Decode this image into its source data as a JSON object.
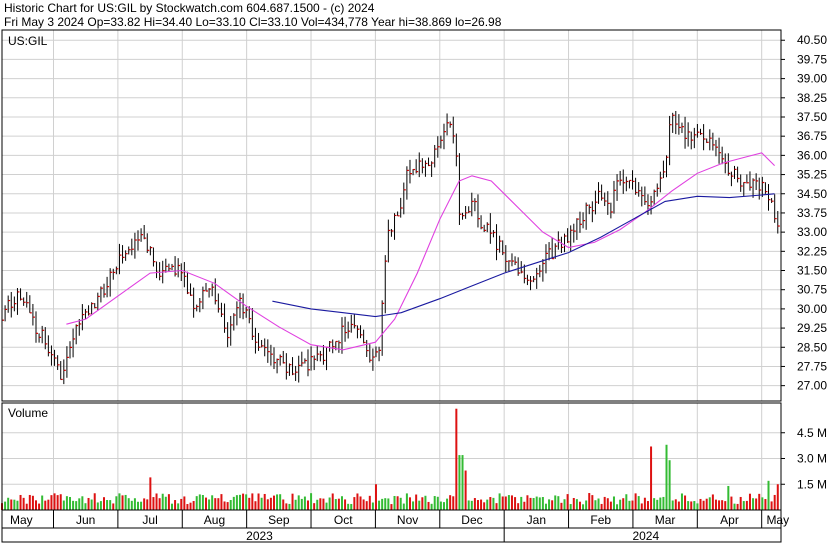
{
  "header": {
    "line1": "Historic Chart for US:GIL by Stockwatch.com 604.687.1500 - (c) 2024",
    "line2": "Fri May  3 2024  Op=33.82  Hi=34.40  Lo=33.10  Cl=33.10  Vol=434,778  Year hi=38.869  lo=26.98"
  },
  "colors": {
    "background": "#ffffff",
    "frame": "#000000",
    "grid": "#d0d0d0",
    "candle_stem": "#000000",
    "close_tick": "#cc0000",
    "ma_short": "#e040e0",
    "ma_long": "#1a1aa0",
    "vol_up": "#33bb33",
    "vol_down": "#dd1111"
  },
  "chart_data": [
    {
      "type": "candlestick",
      "title": "Historic Chart for US:GIL by Stockwatch.com 604.687.1500 - (c) 2024",
      "symbol_label": "US:GIL",
      "ylim": [
        26.4,
        40.9
      ],
      "yticks": [
        27.0,
        27.75,
        28.5,
        29.25,
        30.0,
        30.75,
        31.5,
        32.25,
        33.0,
        33.75,
        34.5,
        35.25,
        36.0,
        36.75,
        37.5,
        38.25,
        39.0,
        39.75,
        40.5
      ],
      "grid": true,
      "x_range_months": [
        0,
        12.1
      ],
      "month_labels": [
        {
          "label": "May",
          "pos": 0.3
        },
        {
          "label": "Jun",
          "pos": 1.3
        },
        {
          "label": "Jul",
          "pos": 2.3
        },
        {
          "label": "Aug",
          "pos": 3.3
        },
        {
          "label": "Sep",
          "pos": 4.3
        },
        {
          "label": "Oct",
          "pos": 5.3
        },
        {
          "label": "Nov",
          "pos": 6.3
        },
        {
          "label": "Dec",
          "pos": 7.3
        },
        {
          "label": "Jan",
          "pos": 8.3
        },
        {
          "label": "Feb",
          "pos": 9.3
        },
        {
          "label": "Mar",
          "pos": 10.3
        },
        {
          "label": "Apr",
          "pos": 11.3
        },
        {
          "label": "May",
          "pos": 12.05
        }
      ],
      "month_dividers": [
        0.8,
        1.8,
        2.8,
        3.8,
        4.8,
        5.8,
        6.8,
        7.8,
        8.8,
        9.8,
        10.8,
        11.8
      ],
      "year_labels": [
        {
          "label": "2023",
          "pos": 4.0
        },
        {
          "label": "2024",
          "pos": 10.0
        }
      ],
      "year_divider": 7.8,
      "price_path": [
        [
          0.0,
          29.8
        ],
        [
          0.3,
          30.6
        ],
        [
          0.45,
          29.6
        ],
        [
          0.7,
          28.6
        ],
        [
          0.9,
          27.4
        ],
        [
          1.2,
          29.4
        ],
        [
          1.6,
          30.8
        ],
        [
          1.9,
          32.4
        ],
        [
          2.2,
          32.7
        ],
        [
          2.45,
          31.4
        ],
        [
          2.75,
          31.5
        ],
        [
          3.0,
          30.0
        ],
        [
          3.2,
          31.1
        ],
        [
          3.5,
          29.0
        ],
        [
          3.7,
          30.2
        ],
        [
          4.0,
          28.6
        ],
        [
          4.5,
          27.5
        ],
        [
          4.9,
          28.0
        ],
        [
          5.2,
          28.8
        ],
        [
          5.45,
          29.6
        ],
        [
          5.7,
          28.0
        ],
        [
          5.85,
          28.4
        ],
        [
          6.0,
          33.1
        ],
        [
          6.2,
          34.0
        ],
        [
          6.3,
          35.4
        ],
        [
          6.6,
          35.7
        ],
        [
          6.8,
          36.4
        ],
        [
          6.95,
          37.3
        ],
        [
          7.05,
          36.6
        ],
        [
          7.1,
          33.6
        ],
        [
          7.3,
          34.2
        ],
        [
          7.45,
          33.4
        ],
        [
          7.7,
          32.5
        ],
        [
          7.95,
          31.6
        ],
        [
          8.25,
          31.1
        ],
        [
          8.5,
          32.1
        ],
        [
          8.8,
          32.9
        ],
        [
          9.1,
          33.9
        ],
        [
          9.3,
          34.5
        ],
        [
          9.45,
          34.0
        ],
        [
          9.6,
          35.2
        ],
        [
          9.9,
          34.5
        ],
        [
          10.1,
          34.2
        ],
        [
          10.3,
          35.7
        ],
        [
          10.4,
          37.7
        ],
        [
          10.55,
          37.0
        ],
        [
          10.7,
          36.8
        ],
        [
          10.9,
          36.7
        ],
        [
          11.15,
          36.0
        ],
        [
          11.3,
          35.4
        ],
        [
          11.5,
          35.0
        ],
        [
          11.75,
          34.9
        ],
        [
          11.95,
          34.3
        ],
        [
          12.05,
          33.1
        ]
      ],
      "ma_short": [
        [
          1.0,
          29.4
        ],
        [
          1.3,
          29.6
        ],
        [
          1.8,
          30.5
        ],
        [
          2.3,
          31.4
        ],
        [
          2.8,
          31.5
        ],
        [
          3.3,
          31.0
        ],
        [
          3.8,
          30.1
        ],
        [
          4.3,
          29.3
        ],
        [
          4.8,
          28.6
        ],
        [
          5.3,
          28.4
        ],
        [
          5.8,
          28.7
        ],
        [
          6.1,
          29.6
        ],
        [
          6.45,
          31.4
        ],
        [
          6.8,
          33.5
        ],
        [
          7.1,
          35.0
        ],
        [
          7.3,
          35.2
        ],
        [
          7.6,
          35.0
        ],
        [
          8.0,
          34.0
        ],
        [
          8.4,
          33.0
        ],
        [
          8.8,
          32.4
        ],
        [
          9.2,
          32.6
        ],
        [
          9.6,
          33.1
        ],
        [
          10.0,
          33.8
        ],
        [
          10.4,
          34.6
        ],
        [
          10.8,
          35.3
        ],
        [
          11.2,
          35.7
        ],
        [
          11.5,
          35.9
        ],
        [
          11.8,
          36.1
        ],
        [
          12.0,
          35.6
        ]
      ],
      "ma_long": [
        [
          4.2,
          30.3
        ],
        [
          4.8,
          30.0
        ],
        [
          5.3,
          29.85
        ],
        [
          5.8,
          29.7
        ],
        [
          6.2,
          29.85
        ],
        [
          6.8,
          30.4
        ],
        [
          7.3,
          30.9
        ],
        [
          7.8,
          31.4
        ],
        [
          8.3,
          31.8
        ],
        [
          8.8,
          32.2
        ],
        [
          9.3,
          32.8
        ],
        [
          9.8,
          33.5
        ],
        [
          10.3,
          34.2
        ],
        [
          10.8,
          34.4
        ],
        [
          11.3,
          34.35
        ],
        [
          11.8,
          34.45
        ],
        [
          12.0,
          34.5
        ]
      ],
      "seed": 2024
    },
    {
      "type": "bar",
      "title": "Volume",
      "yticks": [
        {
          "label": "1.5 M",
          "value": 1.5
        },
        {
          "label": "3.0 M",
          "value": 3.0
        },
        {
          "label": "4.5 M",
          "value": 4.5
        }
      ],
      "ylim": [
        0,
        6.0
      ],
      "base_volume": 0.6,
      "spikes": [
        {
          "x": 2.3,
          "value": 1.9,
          "up": false
        },
        {
          "x": 5.8,
          "value": 1.5,
          "up": false
        },
        {
          "x": 7.08,
          "value": 5.9,
          "up": false
        },
        {
          "x": 7.13,
          "value": 3.2,
          "up": true
        },
        {
          "x": 7.2,
          "value": 2.3,
          "up": false
        },
        {
          "x": 10.1,
          "value": 3.7,
          "up": false
        },
        {
          "x": 10.3,
          "value": 3.8,
          "up": true
        },
        {
          "x": 10.35,
          "value": 2.9,
          "up": true
        },
        {
          "x": 11.3,
          "value": 1.4,
          "up": true
        },
        {
          "x": 11.9,
          "value": 1.7,
          "up": true
        },
        {
          "x": 12.05,
          "value": 1.5,
          "up": false
        }
      ]
    }
  ]
}
